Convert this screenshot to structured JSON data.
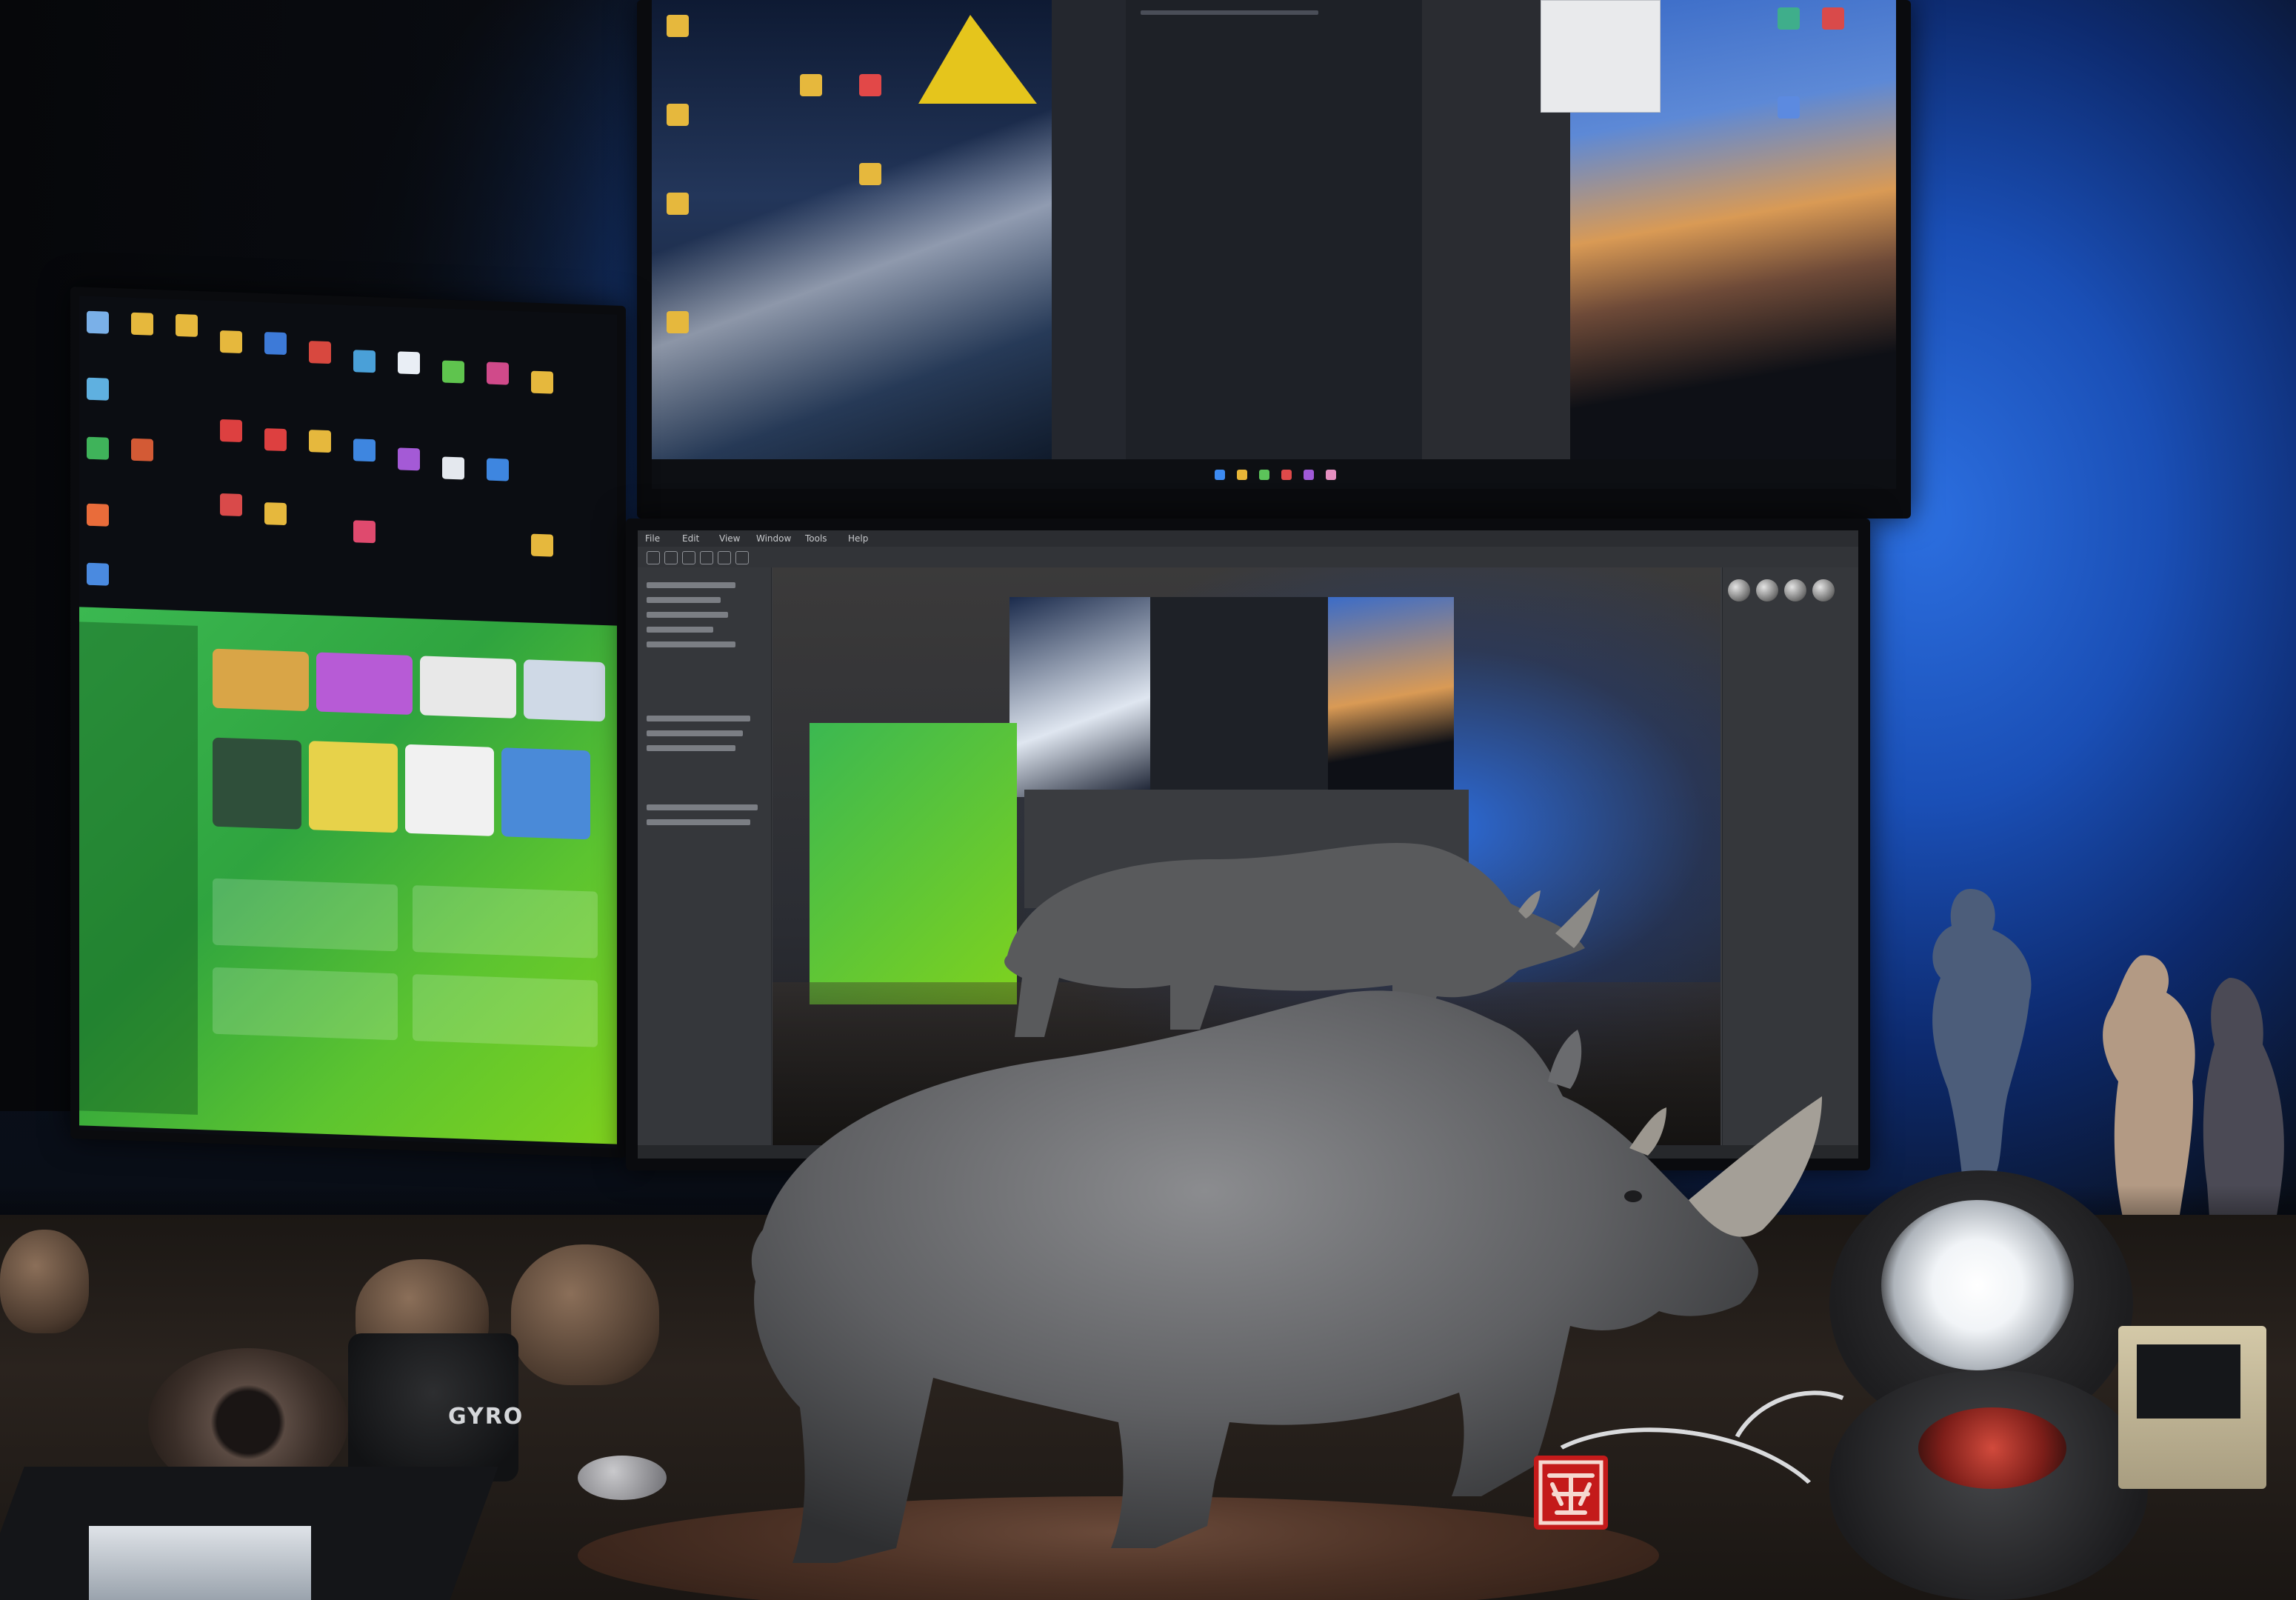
{
  "scene": {
    "description_colors": {
      "wall_blue": "#1a4fb6",
      "screen_green": "#3bb851",
      "desk_wood": "#2a231e",
      "rhino_gray": "#6d6d6d"
    }
  },
  "center_monitor": {
    "menu": [
      "File",
      "Edit",
      "View",
      "Window",
      "Tools",
      "Help"
    ]
  },
  "speaker": {
    "brand": "GYRO"
  },
  "seal": {
    "text": "印"
  }
}
